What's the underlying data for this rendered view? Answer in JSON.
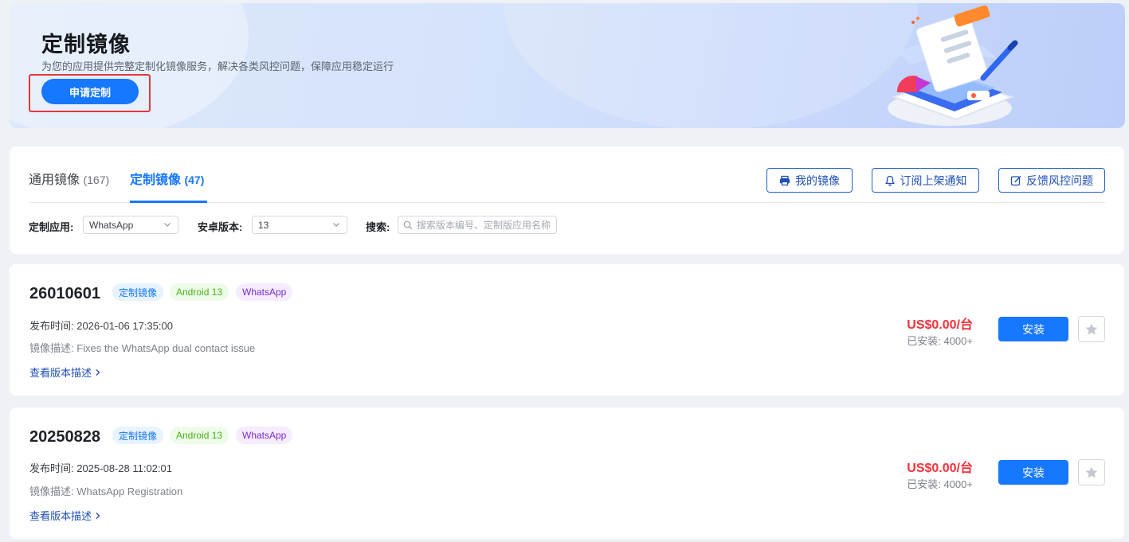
{
  "banner": {
    "title": "定制镜像",
    "subtitle": "为您的应用提供完整定制化镜像服务，解决各类风控问题，保障应用稳定运行",
    "apply_label": "申请定制"
  },
  "tabs": [
    {
      "label": "通用镜像",
      "count": "(167)"
    },
    {
      "label": "定制镜像",
      "count": "(47)"
    }
  ],
  "actions": {
    "my_images": "我的镜像",
    "subscribe": "订阅上架通知",
    "feedback": "反馈风控问题"
  },
  "filters": {
    "app_label": "定制应用:",
    "app_value": "WhatsApp",
    "android_label": "安卓版本:",
    "android_value": "13",
    "search_label": "搜索:",
    "search_placeholder": "搜索版本编号、定制版应用名称"
  },
  "items": [
    {
      "version": "26010601",
      "tags": [
        "定制镜像",
        "Android 13",
        "WhatsApp"
      ],
      "date": "发布时间: 2026-01-06 17:35:00",
      "desc": "镜像描述: Fixes the WhatsApp dual contact issue",
      "link": "查看版本描述",
      "price": "US$0.00/台",
      "installed": "已安装: 4000+",
      "install_label": "安装"
    },
    {
      "version": "20250828",
      "tags": [
        "定制镜像",
        "Android 13",
        "WhatsApp"
      ],
      "date": "发布时间: 2025-08-28 11:02:01",
      "desc": "镜像描述: WhatsApp Registration",
      "link": "查看版本描述",
      "price": "US$0.00/台",
      "installed": "已安装: 4000+",
      "install_label": "安装"
    }
  ],
  "icons": {
    "my_images": "printer-icon",
    "subscribe": "bell-icon",
    "feedback": "edit-icon",
    "search": "search-icon",
    "favorite": "star-icon",
    "link_arrow": "chevron-right-icon"
  },
  "colors": {
    "primary": "#1677ff",
    "price": "#f5313a",
    "android_tag": "#46b316",
    "app_tag": "#7a2ed1"
  }
}
